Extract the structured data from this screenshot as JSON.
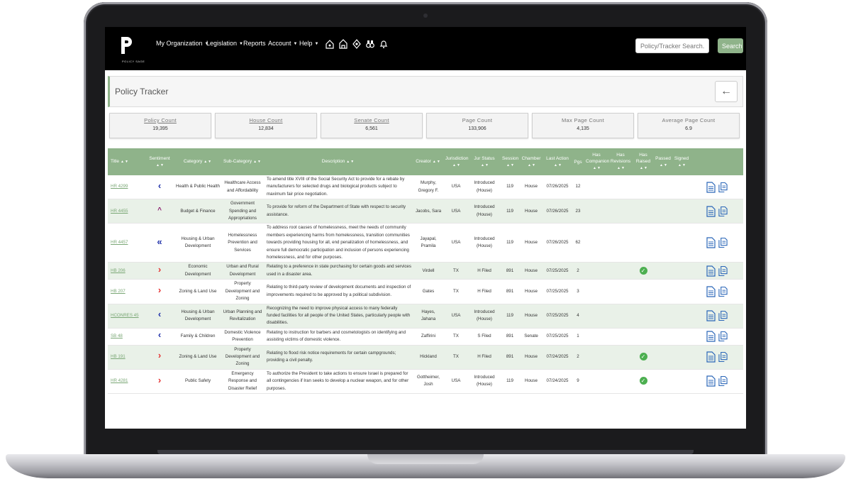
{
  "nav": {
    "logo_text": "POLICY SAGE",
    "menu": [
      "My Organization",
      "Legislation",
      "Reports",
      "Account",
      "Help"
    ],
    "search_placeholder": "Policy/Tracker Search...",
    "search_label": "Search"
  },
  "page": {
    "title": "Policy Tracker",
    "back_icon": "arrow-left-icon"
  },
  "stats": [
    {
      "label": "Policy Count",
      "value": "19,395"
    },
    {
      "label": "House Count",
      "value": "12,834"
    },
    {
      "label": "Senate Count",
      "value": "6,561"
    },
    {
      "label": "Page Count",
      "value": "133,906"
    },
    {
      "label": "Max Page Count",
      "value": "4,135"
    },
    {
      "label": "Average Page Count",
      "value": "6.9"
    }
  ],
  "table": {
    "headers": [
      "Title",
      "Sentiment",
      "Category",
      "Sub-Category",
      "Description",
      "Creator",
      "Jurisdiction",
      "Jur Status",
      "Session",
      "Chamber",
      "Last Action",
      "Pgs",
      "Has Companion",
      "Has Revisions",
      "Has Raised",
      "Passed",
      "Signed"
    ],
    "rows": [
      {
        "title": "HR 4299",
        "sentiment": "‹",
        "sent_color": "blue",
        "category": "Health & Public Health",
        "subcategory": "Healthcare Access and Affordability",
        "description": "To amend title XVIII of the Social Security Act to provide for a rebate by manufacturers for selected drugs and biological products subject to maximum fair price negotiation.",
        "creator": "Murphy, Gregory F.",
        "jurisdiction": "USA",
        "status": "Introduced (House)",
        "session": "119",
        "chamber": "House",
        "last_action": "07/26/2025",
        "pgs": "12",
        "raised": false
      },
      {
        "title": "HR 4455",
        "sentiment": "^",
        "sent_color": "purple",
        "category": "Budget & Finance",
        "subcategory": "Government Spending and Appropriations",
        "description": "To provide for reform of the Department of State with respect to security assistance.",
        "creator": "Jacobs, Sara",
        "jurisdiction": "USA",
        "status": "Introduced (House)",
        "session": "119",
        "chamber": "House",
        "last_action": "07/26/2025",
        "pgs": "23",
        "raised": false
      },
      {
        "title": "HR 4457",
        "sentiment": "«",
        "sent_color": "blue",
        "category": "Housing & Urban Development",
        "subcategory": "Homelessness Prevention and Services",
        "description": "To address root causes of homelessness, meet the needs of community members experiencing harms from homelessness, transition communities towards providing housing for all, end penalization of homelessness, and ensure full democratic participation and inclusion of persons experiencing homelessness, and for other purposes.",
        "creator": "Jayapal, Pramila",
        "jurisdiction": "USA",
        "status": "Introduced (House)",
        "session": "119",
        "chamber": "House",
        "last_action": "07/26/2025",
        "pgs": "62",
        "raised": false
      },
      {
        "title": "HB 206",
        "sentiment": "›",
        "sent_color": "red",
        "category": "Economic Development",
        "subcategory": "Urban and Rural Development",
        "description": "Relating to a preference in state purchasing for certain goods and services used in a disaster area.",
        "creator": "Virdell",
        "jurisdiction": "TX",
        "status": "H Filed",
        "session": "891",
        "chamber": "House",
        "last_action": "07/25/2025",
        "pgs": "2",
        "raised": true
      },
      {
        "title": "HB 207",
        "sentiment": "›",
        "sent_color": "red",
        "category": "Zoning & Land Use",
        "subcategory": "Property Development and Zoning",
        "description": "Relating to third-party review of development documents and inspection of improvements required to be approved by a political subdivision.",
        "creator": "Gates",
        "jurisdiction": "TX",
        "status": "H Filed",
        "session": "891",
        "chamber": "House",
        "last_action": "07/25/2025",
        "pgs": "3",
        "raised": false
      },
      {
        "title": "HCONRES 45",
        "sentiment": "‹",
        "sent_color": "blue",
        "category": "Housing & Urban Development",
        "subcategory": "Urban Planning and Revitalization",
        "description": "Recognizing the need to improve physical access to many federally funded facilities for all people of the United States, particularly people with disabilities.",
        "creator": "Hayes, Jahana",
        "jurisdiction": "USA",
        "status": "Introduced (House)",
        "session": "119",
        "chamber": "House",
        "last_action": "07/25/2025",
        "pgs": "4",
        "raised": false
      },
      {
        "title": "SB 48",
        "sentiment": "‹",
        "sent_color": "blue",
        "category": "Family & Children",
        "subcategory": "Domestic Violence Prevention",
        "description": "Relating to instruction for barbers and cosmetologists on identifying and assisting victims of domestic violence.",
        "creator": "Zaffirini",
        "jurisdiction": "TX",
        "status": "S Filed",
        "session": "891",
        "chamber": "Senate",
        "last_action": "07/25/2025",
        "pgs": "1",
        "raised": false
      },
      {
        "title": "HB 191",
        "sentiment": "›",
        "sent_color": "red",
        "category": "Zoning & Land Use",
        "subcategory": "Property Development and Zoning",
        "description": "Relating to flood risk notice requirements for certain campgrounds; providing a civil penalty.",
        "creator": "Hickland",
        "jurisdiction": "TX",
        "status": "H Filed",
        "session": "891",
        "chamber": "House",
        "last_action": "07/24/2025",
        "pgs": "2",
        "raised": true
      },
      {
        "title": "HR 4281",
        "sentiment": "›",
        "sent_color": "red",
        "category": "Public Safety",
        "subcategory": "Emergency Response and Disaster Relief",
        "description": "To authorize the President to take actions to ensure Israel is prepared for all contingencies if Iran seeks to develop a nuclear weapon, and for other purposes.",
        "creator": "Gottheimer, Josh",
        "jurisdiction": "USA",
        "status": "Introduced (House)",
        "session": "119",
        "chamber": "House",
        "last_action": "07/24/2025",
        "pgs": "9",
        "raised": true
      }
    ]
  }
}
